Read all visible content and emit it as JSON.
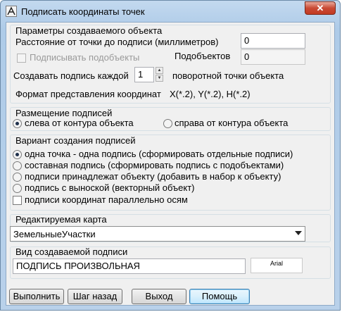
{
  "window": {
    "title": "Подписать координаты точек",
    "close_glyph": "✕"
  },
  "params": {
    "legend": "Параметры создаваемого объекта",
    "distance_label": "Расстояние от точки до подписи (миллиметров)",
    "distance_value": "0",
    "sign_subobjects_label": "Подписывать подобъекты",
    "subobjects_label": "Подобъектов",
    "subobjects_value": "0",
    "each_label": "Создавать подпись каждой",
    "each_value": "1",
    "each_suffix": "поворотной точки объекта",
    "format_label": "Формат представления координат",
    "format_value": "X(*.2),  Y(*.2),  H(*.2)"
  },
  "placement": {
    "legend": "Размещение подписей",
    "left_label": "слева от контура объекта",
    "right_label": "справа от контура объекта",
    "selected": "left"
  },
  "variant": {
    "legend": "Вариант создания подписей",
    "options": [
      "одна точка - одна подпись (сформировать отдельные подписи)",
      "составная подпись (сформировать подпись с подобъектами)",
      "подписи принадлежат объекту (добавить в набор к объекту)",
      "подпись с выноской (векторный объект)"
    ],
    "selected_index": 0,
    "parallel_label": "подписи координат параллельно осям"
  },
  "map": {
    "legend": "Редактируемая карта",
    "selected": "ЗемельныеУчастки"
  },
  "label_view": {
    "legend": "Вид создаваемой подписи",
    "value": "ПОДПИСЬ ПРОИЗВОЛЬНАЯ",
    "font_button": "Arial"
  },
  "buttons": {
    "execute": "Выполнить",
    "back": "Шаг назад",
    "exit": "Выход",
    "help": "Помощь"
  },
  "colors": {
    "title_bar": "#c3d9ef",
    "close_button": "#c94a34",
    "client": "#f0f0f0"
  }
}
